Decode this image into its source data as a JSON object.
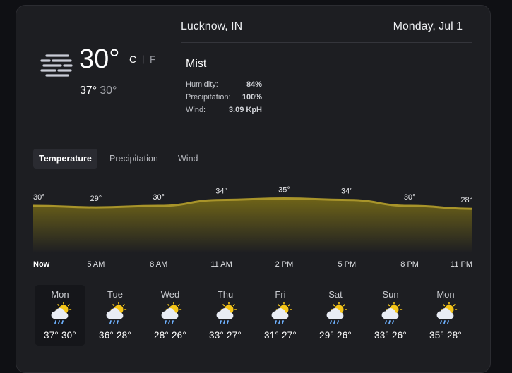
{
  "current": {
    "temperature": "30°",
    "unit_c": "C",
    "unit_sep": "|",
    "unit_f": "F",
    "high": "37°",
    "low": "30°",
    "icon": "mist-icon"
  },
  "location": "Lucknow, IN",
  "date": "Monday, Jul 1",
  "condition": "Mist",
  "stats": {
    "humidity_label": "Humidity:",
    "humidity_value": "84%",
    "precip_label": "Precipitation:",
    "precip_value": "100%",
    "wind_label": "Wind:",
    "wind_value": "3.09 KpH"
  },
  "tabs": [
    "Temperature",
    "Precipitation",
    "Wind"
  ],
  "colors": {
    "chart_line": "#a8942a",
    "chart_fill_top": "#6f6418",
    "chart_fill_bottom": "#1d1e22",
    "sun": "#f5c518",
    "cloud": "#e8ecf4",
    "rain": "#6fb2ff"
  },
  "chart_data": {
    "type": "area",
    "x": [
      "Now",
      "5 AM",
      "8 AM",
      "11 AM",
      "2 PM",
      "5 PM",
      "8 PM",
      "11 PM"
    ],
    "values": [
      30,
      29,
      30,
      34,
      35,
      34,
      30,
      28
    ],
    "labels": [
      "30°",
      "29°",
      "30°",
      "34°",
      "35°",
      "34°",
      "30°",
      "28°"
    ]
  },
  "forecast": [
    {
      "day": "Mon",
      "high": "37°",
      "low": "30°",
      "icon": "sun-cloud-rain-icon"
    },
    {
      "day": "Tue",
      "high": "36°",
      "low": "28°",
      "icon": "sun-cloud-rain-icon"
    },
    {
      "day": "Wed",
      "high": "28°",
      "low": "26°",
      "icon": "sun-cloud-rain-icon"
    },
    {
      "day": "Thu",
      "high": "33°",
      "low": "27°",
      "icon": "sun-cloud-rain-icon"
    },
    {
      "day": "Fri",
      "high": "31°",
      "low": "27°",
      "icon": "sun-cloud-rain-icon"
    },
    {
      "day": "Sat",
      "high": "29°",
      "low": "26°",
      "icon": "sun-cloud-rain-icon"
    },
    {
      "day": "Sun",
      "high": "33°",
      "low": "26°",
      "icon": "sun-cloud-rain-icon"
    },
    {
      "day": "Mon",
      "high": "35°",
      "low": "28°",
      "icon": "sun-cloud-rain-icon"
    }
  ]
}
